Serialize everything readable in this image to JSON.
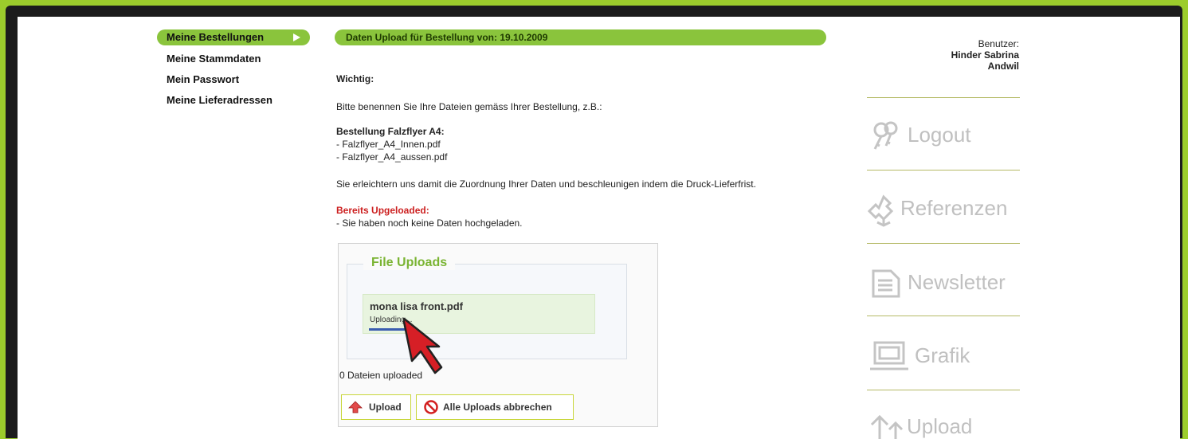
{
  "nav": {
    "items": [
      {
        "label": "Meine Bestellungen",
        "active": true
      },
      {
        "label": "Meine Stammdaten"
      },
      {
        "label": "Mein Passwort"
      },
      {
        "label": "Meine Lieferadressen"
      }
    ]
  },
  "main": {
    "title": "Daten Upload für Bestellung von: 19.10.2009",
    "important_label": "Wichtig:",
    "instruction": "Bitte benennen Sie Ihre Dateien gemäss Ihrer Bestellung, z.B.:",
    "example_title": "Bestellung Falzflyer A4:",
    "example_files": [
      "- Falzflyer_A4_Innen.pdf",
      "- Falzflyer_A4_aussen.pdf"
    ],
    "note": "Sie erleichtern uns damit die Zuordnung Ihrer Daten und beschleunigen indem die Druck-Lieferfrist.",
    "uploaded_label": "Bereits Upgeloaded:",
    "uploaded_status": "- Sie haben noch keine Daten hochgeladen."
  },
  "uploader": {
    "legend": "File Uploads",
    "file_name": "mona lisa front.pdf",
    "file_status": "Uploading...",
    "count_text": "0 Dateien uploaded",
    "upload_button": "Upload",
    "cancel_button": "Alle Uploads abbrechen"
  },
  "user": {
    "label": "Benutzer:",
    "name": "Hinder Sabrina",
    "location": "Andwil"
  },
  "side_menu": [
    {
      "label": "Logout",
      "icon": "keys-icon"
    },
    {
      "label": "Referenzen",
      "icon": "puzzle-icon"
    },
    {
      "label": "Newsletter",
      "icon": "document-icon"
    },
    {
      "label": "Grafik",
      "icon": "laptop-icon"
    },
    {
      "label": "Upload",
      "icon": "upload-arrows-icon"
    }
  ],
  "colors": {
    "accent_green": "#8ac43c",
    "frame_green": "#9ccc2c",
    "error_red": "#cc1f1f"
  }
}
